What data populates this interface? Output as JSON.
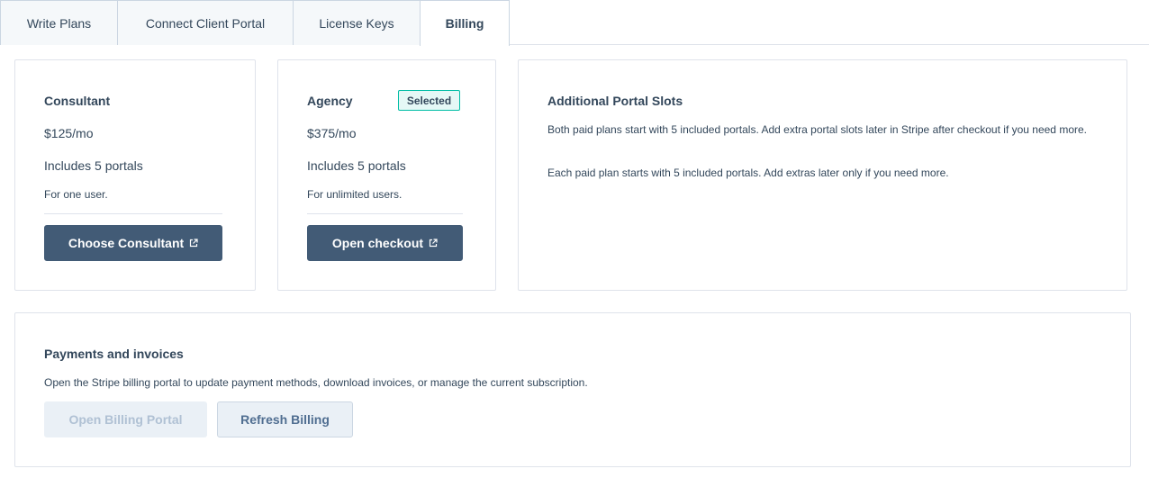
{
  "tabs": [
    {
      "label": "Write Plans"
    },
    {
      "label": "Connect Client Portal"
    },
    {
      "label": "License Keys"
    },
    {
      "label": "Billing"
    }
  ],
  "plans": {
    "consultant": {
      "title": "Consultant",
      "price": "$125/mo",
      "portals": "Includes 5 portals",
      "users": "For one user.",
      "button": "Choose Consultant"
    },
    "agency": {
      "title": "Agency",
      "badge": "Selected",
      "price": "$375/mo",
      "portals": "Includes 5 portals",
      "users": "For unlimited users.",
      "button": "Open checkout"
    }
  },
  "slots": {
    "title": "Additional Portal Slots",
    "para1": "Both paid plans start with 5 included portals. Add extra portal slots later in Stripe after checkout if you need more.",
    "para2": "Each paid plan starts with 5 included portals. Add extras later only if you need more."
  },
  "payments": {
    "title": "Payments and invoices",
    "description": "Open the Stripe billing portal to update payment methods, download invoices, or manage the current subscription.",
    "open_portal": "Open Billing Portal",
    "refresh": "Refresh Billing"
  },
  "icons": {
    "external": "external-link-icon"
  },
  "colors": {
    "primary_button": "#425b76",
    "selected_border": "#00bda5",
    "text": "#33475b"
  }
}
